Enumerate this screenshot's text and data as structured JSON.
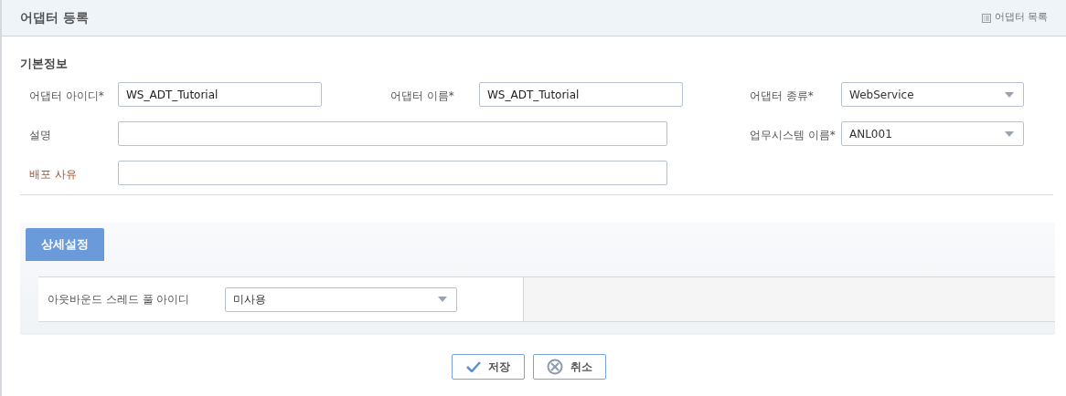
{
  "header": {
    "title": "어댑터 등록",
    "link": "어댑터 목록"
  },
  "basic": {
    "title": "기본정보",
    "fields": [
      {
        "label": "어댑터 아이디*",
        "kind": "input",
        "value": "WS_ADT_Tutorial",
        "highlighted": false
      },
      {
        "label": "어댑터 이름*",
        "kind": "input",
        "value": "WS_ADT_Tutorial",
        "highlighted": false
      },
      {
        "label": "어댑터 종류*",
        "kind": "select",
        "value": "WebService",
        "highlighted": false
      },
      {
        "label": "설명",
        "kind": "wide",
        "highlighted": false
      },
      {
        "label": "업무시스템 이름*",
        "kind": "select",
        "value": "ANL001",
        "highlighted": false
      },
      {
        "label": "배포 사유",
        "kind": "wide",
        "highlighted": true
      }
    ]
  },
  "detail": {
    "tab": "상세설정",
    "field": {
      "label": "아웃바운드 스레드 풀 아이디",
      "value": "미사용"
    }
  },
  "buttons": [
    {
      "label": "저장",
      "kind": "save"
    },
    {
      "label": "취소",
      "kind": "cancel"
    }
  ]
}
